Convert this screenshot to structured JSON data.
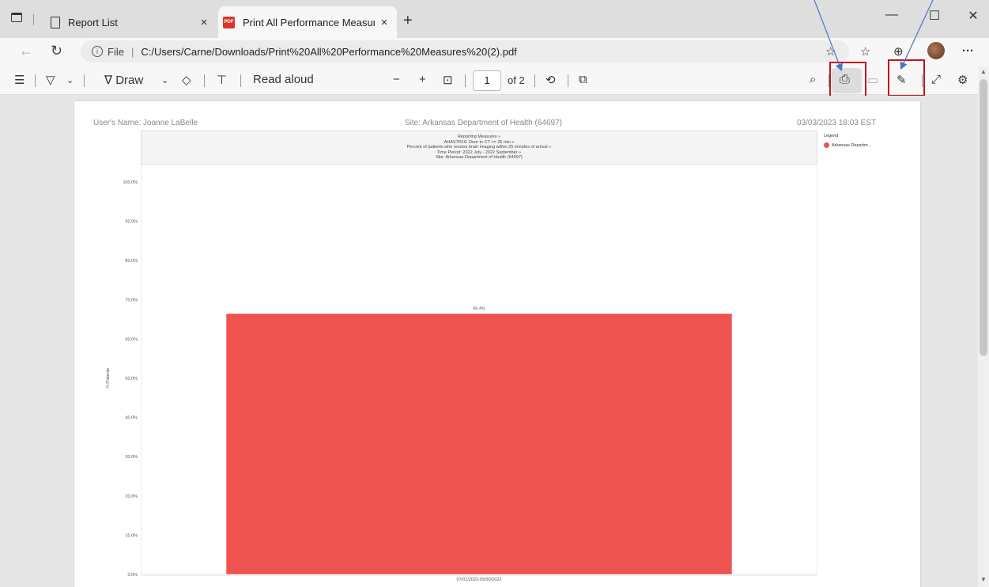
{
  "tabs": [
    {
      "title": "Report List",
      "close": "×"
    },
    {
      "title": "Print All Performance Measures (",
      "close": "×",
      "icon_text": "PDF"
    }
  ],
  "new_tab": "+",
  "window_controls": {
    "minimize": "—",
    "maximize": "☐",
    "close": "✕"
  },
  "address": {
    "scheme": "File",
    "separator": "|",
    "url": "C:/Users/Carne/Downloads/Print%20All%20Performance%20Measures%20(2).pdf"
  },
  "more_menu": "···",
  "toolbar": {
    "draw_label": "Draw",
    "read_aloud_label": "Read aloud",
    "zoom_out": "−",
    "zoom_in": "+",
    "page_current": "1",
    "page_total": "of 2"
  },
  "document": {
    "user_name": "User's Name: Joanne LaBelle",
    "site": "Site: Arkansas Department of Health (64697)",
    "timestamp": "03/03/2023 18:03 EST",
    "header_lines": [
      "Reporting Measures »",
      "AHASTR16: Door to CT <= 25 min »",
      "Percent of patients who receive brain imaging within 25 minutes of arrival »",
      "Time Period: 2022 July - 2022 September »",
      "Site: Arkansas Department of Health (64697)"
    ],
    "legend_title": "Legend",
    "legend_item": "Arkansas Departm..."
  },
  "chart_data": {
    "type": "bar",
    "categories": [
      "07/01/2022-09/30/2022"
    ],
    "series": [
      {
        "name": "Arkansas Departm...",
        "values": [
          66.4
        ]
      }
    ],
    "data_labels": [
      "66.4%"
    ],
    "ylabel": "% Patients",
    "ylim": [
      0,
      100
    ],
    "yticks": [
      "0.0%",
      "10.0%",
      "20.0%",
      "30.0%",
      "40.0%",
      "50.0%",
      "60.0%",
      "70.0%",
      "80.0%",
      "90.0%",
      "100.0%"
    ],
    "bar_color": "#ef5350",
    "grid": false
  },
  "colors": {
    "highlight": "#c0171c",
    "arrow": "#4a74c9"
  }
}
